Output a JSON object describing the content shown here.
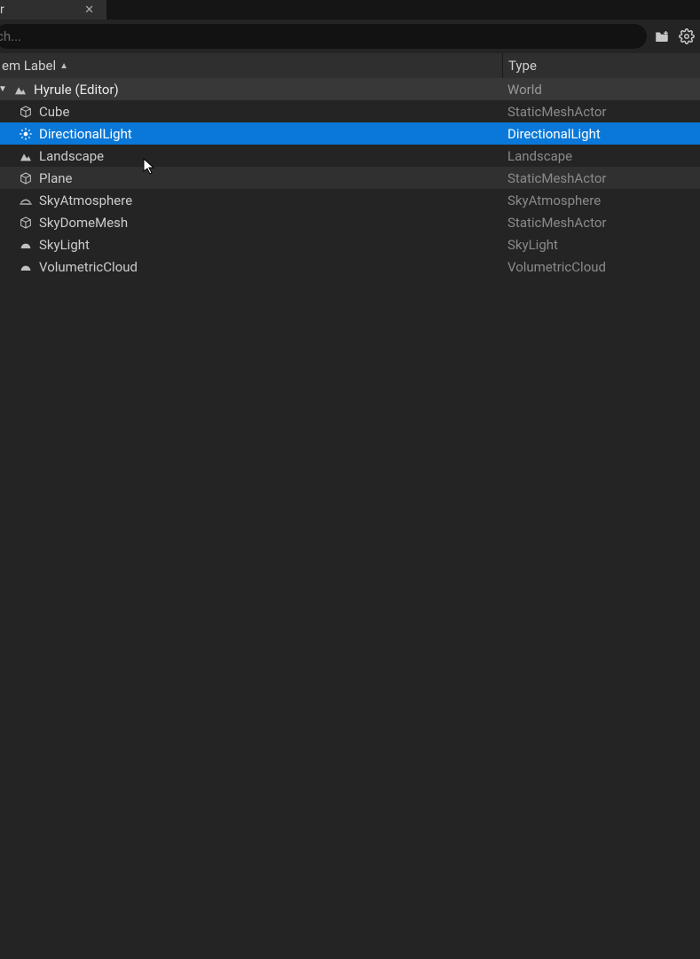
{
  "tab": {
    "title": "r"
  },
  "search": {
    "placeholder": "ch..."
  },
  "columns": {
    "label": "em Label",
    "type": "Type"
  },
  "root": {
    "name": "Hyrule (Editor)",
    "type": "World"
  },
  "items": [
    {
      "name": "Cube",
      "type": "StaticMeshActor",
      "icon": "mesh",
      "state": ""
    },
    {
      "name": "DirectionalLight",
      "type": "DirectionalLight",
      "icon": "sun",
      "state": "selected"
    },
    {
      "name": "Landscape",
      "type": "Landscape",
      "icon": "landscape",
      "state": ""
    },
    {
      "name": "Plane",
      "type": "StaticMeshActor",
      "icon": "mesh",
      "state": "hover"
    },
    {
      "name": "SkyAtmosphere",
      "type": "SkyAtmosphere",
      "icon": "atmosphere",
      "state": ""
    },
    {
      "name": "SkyDomeMesh",
      "type": "StaticMeshActor",
      "icon": "mesh",
      "state": ""
    },
    {
      "name": "SkyLight",
      "type": "SkyLight",
      "icon": "dome",
      "state": ""
    },
    {
      "name": "VolumetricCloud",
      "type": "VolumetricCloud",
      "icon": "dome",
      "state": ""
    }
  ]
}
